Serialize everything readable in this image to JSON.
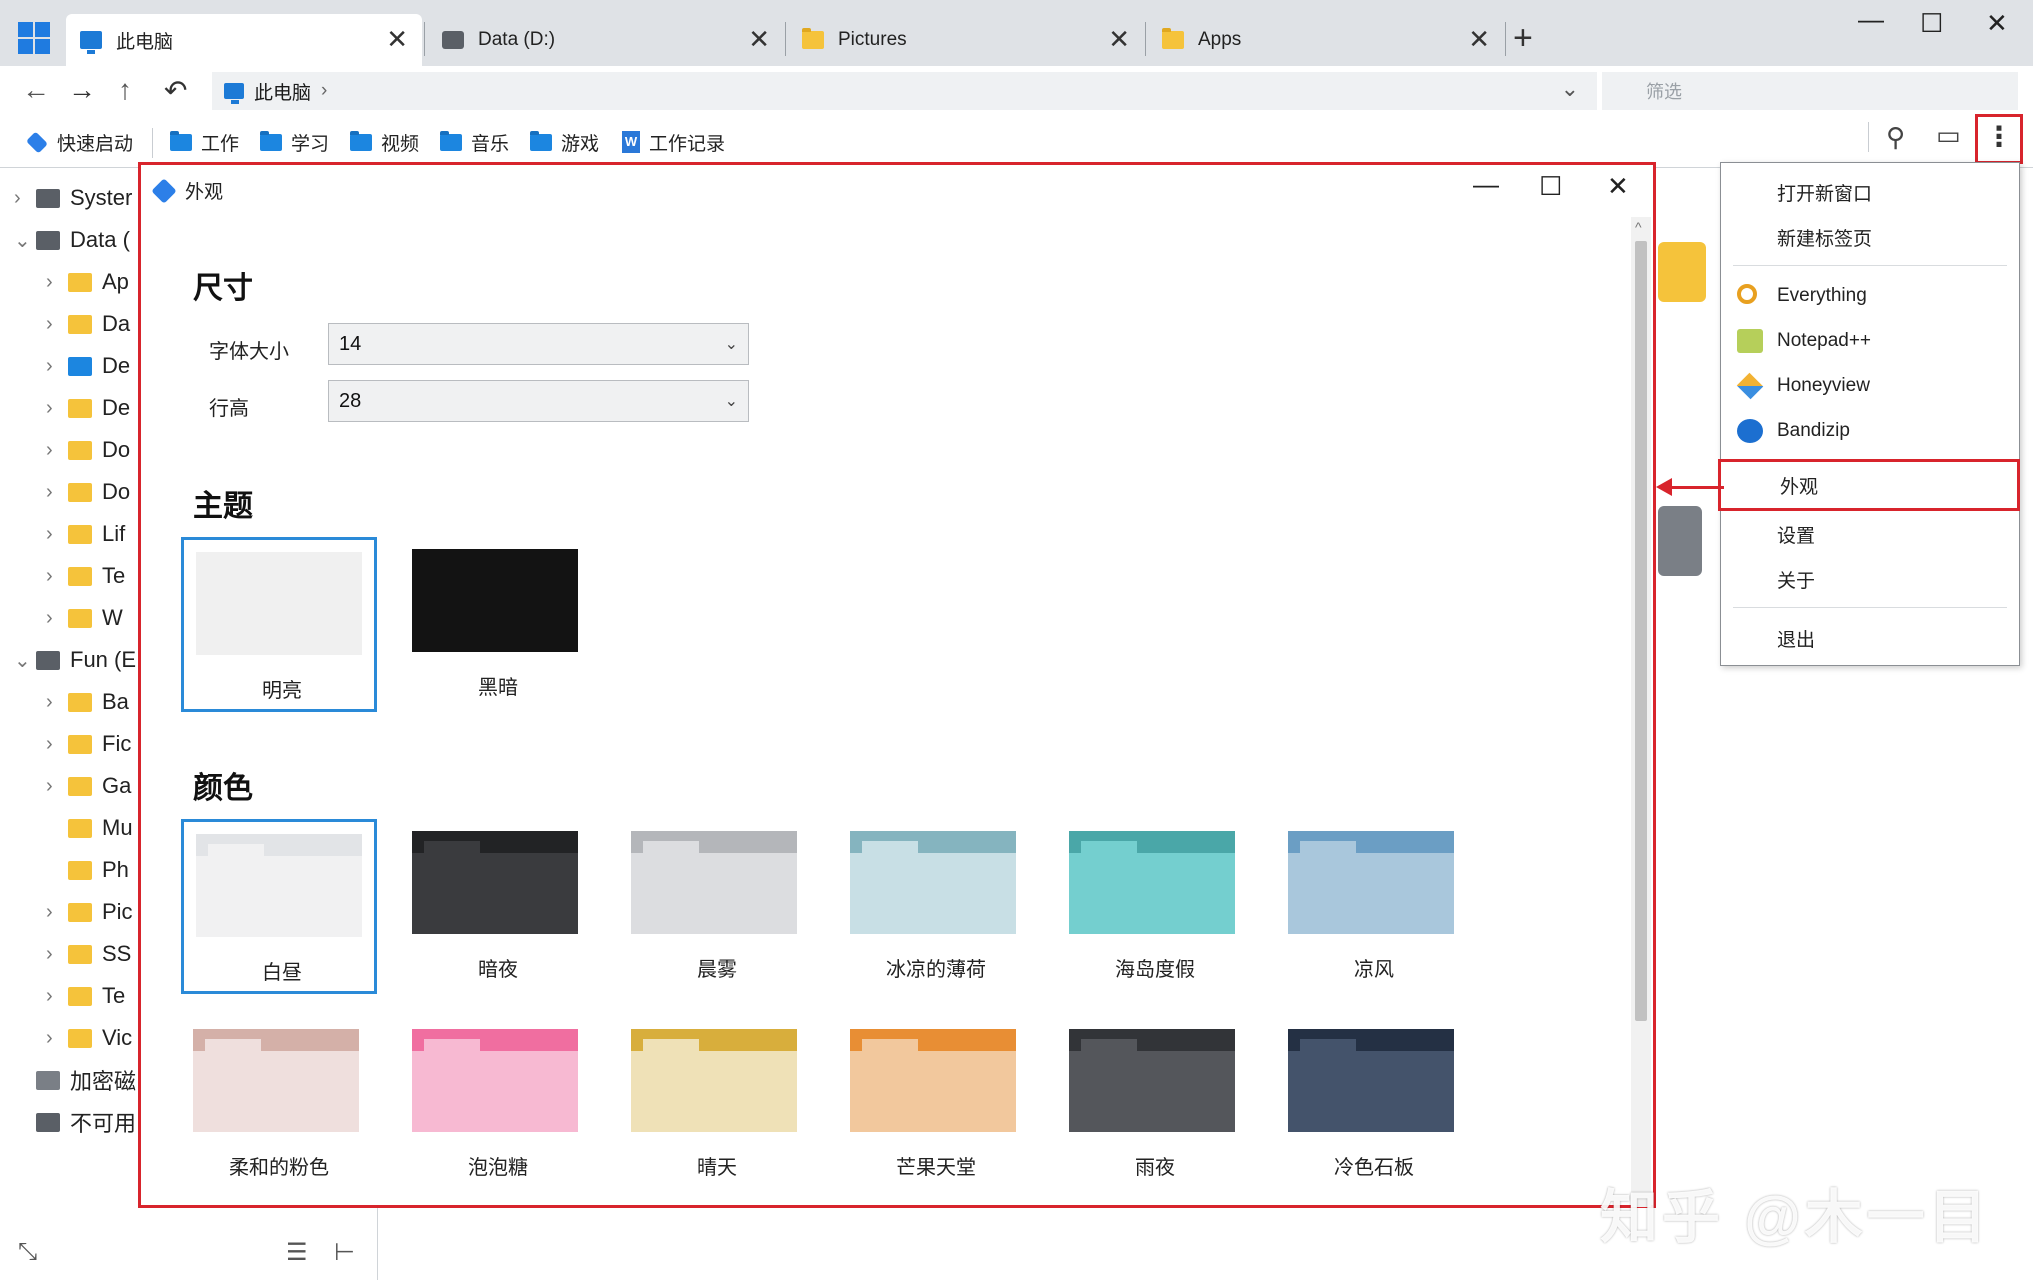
{
  "tabs": [
    {
      "label": "此电脑",
      "icon": "computer-icon",
      "active": true
    },
    {
      "label": "Data (D:)",
      "icon": "drive-icon",
      "active": false
    },
    {
      "label": "Pictures",
      "icon": "folder-icon",
      "active": false
    },
    {
      "label": "Apps",
      "icon": "folder-icon",
      "active": false
    }
  ],
  "address": {
    "path": "此电脑",
    "filter_placeholder": "筛选"
  },
  "bookmarks": [
    {
      "label": "快速启动",
      "icon": "quick-launch-icon"
    },
    {
      "label": "工作",
      "icon": "folder-icon"
    },
    {
      "label": "学习",
      "icon": "folder-icon"
    },
    {
      "label": "视频",
      "icon": "folder-icon"
    },
    {
      "label": "音乐",
      "icon": "folder-icon"
    },
    {
      "label": "游戏",
      "icon": "folder-icon"
    },
    {
      "label": "工作记录",
      "icon": "word-doc-icon"
    }
  ],
  "sidebar": {
    "items": [
      {
        "label": "Syster",
        "level": 0,
        "expander": "collapsed",
        "icon": "drive-icon"
      },
      {
        "label": "Data (",
        "level": 0,
        "expander": "expanded",
        "icon": "drive-icon"
      },
      {
        "label": "Ap",
        "level": 1,
        "expander": "collapsed",
        "icon": "folder-icon"
      },
      {
        "label": "Da",
        "level": 1,
        "expander": "collapsed",
        "icon": "folder-icon"
      },
      {
        "label": "De",
        "level": 1,
        "expander": "collapsed",
        "icon": "desktop-folder-icon"
      },
      {
        "label": "De",
        "level": 1,
        "expander": "collapsed",
        "icon": "folder-icon"
      },
      {
        "label": "Do",
        "level": 1,
        "expander": "collapsed",
        "icon": "documents-folder-icon"
      },
      {
        "label": "Do",
        "level": 1,
        "expander": "collapsed",
        "icon": "downloads-folder-icon"
      },
      {
        "label": "Lif",
        "level": 1,
        "expander": "collapsed",
        "icon": "folder-icon"
      },
      {
        "label": "Te",
        "level": 1,
        "expander": "collapsed",
        "icon": "folder-icon"
      },
      {
        "label": "W",
        "level": 1,
        "expander": "collapsed",
        "icon": "folder-icon"
      },
      {
        "label": "Fun (E",
        "level": 0,
        "expander": "expanded",
        "icon": "drive-icon"
      },
      {
        "label": "Ba",
        "level": 1,
        "expander": "collapsed",
        "icon": "folder-icon"
      },
      {
        "label": "Fic",
        "level": 1,
        "expander": "collapsed",
        "icon": "folder-icon"
      },
      {
        "label": "Ga",
        "level": 1,
        "expander": "collapsed",
        "icon": "folder-icon"
      },
      {
        "label": "Mu",
        "level": 1,
        "expander": "none",
        "icon": "music-folder-icon"
      },
      {
        "label": "Ph",
        "level": 1,
        "expander": "none",
        "icon": "folder-icon"
      },
      {
        "label": "Pic",
        "level": 1,
        "expander": "collapsed",
        "icon": "pictures-folder-icon"
      },
      {
        "label": "SS",
        "level": 1,
        "expander": "collapsed",
        "icon": "folder-icon"
      },
      {
        "label": "Te",
        "level": 1,
        "expander": "collapsed",
        "icon": "folder-icon"
      },
      {
        "label": "Vic",
        "level": 1,
        "expander": "collapsed",
        "icon": "videos-folder-icon"
      },
      {
        "label": "加密磁",
        "level": 0,
        "expander": "none",
        "icon": "locked-drive-icon"
      },
      {
        "label": "不可用",
        "level": 0,
        "expander": "none",
        "icon": "network-drive-icon"
      }
    ]
  },
  "menu": {
    "items": [
      {
        "label": "打开新窗口",
        "icon": ""
      },
      {
        "label": "新建标签页",
        "icon": ""
      },
      {
        "label": "Everything",
        "icon": "everything-search-icon"
      },
      {
        "label": "Notepad++",
        "icon": "notepadpp-icon"
      },
      {
        "label": "Honeyview",
        "icon": "honeyview-icon"
      },
      {
        "label": "Bandizip",
        "icon": "bandizip-icon"
      },
      {
        "label": "外观",
        "icon": ""
      },
      {
        "label": "设置",
        "icon": ""
      },
      {
        "label": "关于",
        "icon": ""
      },
      {
        "label": "退出",
        "icon": ""
      }
    ]
  },
  "dialog": {
    "title": "外观",
    "size_section": "尺寸",
    "font_size_label": "字体大小",
    "font_size_value": "14",
    "line_height_label": "行高",
    "line_height_value": "28",
    "theme_section": "主题",
    "themes": [
      {
        "label": "明亮",
        "color": "#f0f0f0",
        "selected": true
      },
      {
        "label": "黑暗",
        "color": "#131313",
        "selected": false
      }
    ],
    "color_section": "颜色",
    "colors": [
      {
        "label": "白昼",
        "tab": "#e2e4e7",
        "body": "#f1f1f2",
        "inner": "#f1f1f2",
        "selected": true
      },
      {
        "label": "暗夜",
        "tab": "#222325",
        "body": "#3a3b3e",
        "inner": "#3a3b3e",
        "selected": false
      },
      {
        "label": "晨雾",
        "tab": "#b4b6ba",
        "body": "#dcdde0",
        "inner": "#dcdde0",
        "selected": false
      },
      {
        "label": "冰凉的薄荷",
        "tab": "#85b4bf",
        "body": "#c8dfe5",
        "inner": "#c8dfe5",
        "selected": false
      },
      {
        "label": "海岛度假",
        "tab": "#4aa7a8",
        "body": "#74cfcf",
        "inner": "#74cfcf",
        "selected": false
      },
      {
        "label": "凉风",
        "tab": "#6b9ec4",
        "body": "#a9c7dc",
        "inner": "#a9c7dc",
        "selected": false
      },
      {
        "label": "柔和的粉色",
        "tab": "#d4b0a8",
        "body": "#efdfdd",
        "inner": "#efdfdd",
        "selected": false
      },
      {
        "label": "泡泡糖",
        "tab": "#f06ea0",
        "body": "#f7b9d2",
        "inner": "#f7b9d2",
        "selected": false
      },
      {
        "label": "晴天",
        "tab": "#d8ae3c",
        "body": "#efe1b7",
        "inner": "#efe1b7",
        "selected": false
      },
      {
        "label": "芒果天堂",
        "tab": "#e88e34",
        "body": "#f2c89d",
        "inner": "#f2c89d",
        "selected": false
      },
      {
        "label": "雨夜",
        "tab": "#323438",
        "body": "#54565b",
        "inner": "#54565b",
        "selected": false
      },
      {
        "label": "冷色石板",
        "tab": "#243044",
        "body": "#44536b",
        "inner": "#44536b",
        "selected": false
      }
    ]
  },
  "watermark": "知乎 @木一目",
  "accent_colors": {
    "highlight_red": "#d8242c",
    "selection_blue": "#2a8ad8"
  }
}
